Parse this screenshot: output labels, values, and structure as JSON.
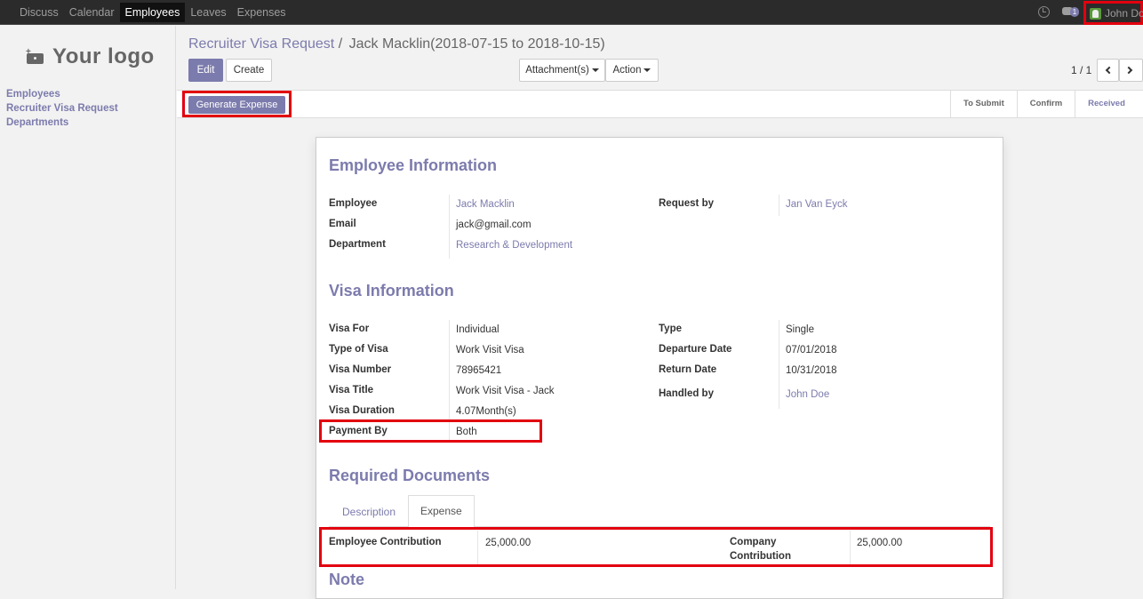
{
  "topbar": {
    "menu": [
      "Discuss",
      "Calendar",
      "Employees",
      "Leaves",
      "Expenses"
    ],
    "active_index": 2,
    "chat_count": "1",
    "user_name": "John Doe"
  },
  "sidebar": {
    "logo_text": "Your logo",
    "links": [
      "Employees",
      "Recruiter Visa Request",
      "Departments"
    ]
  },
  "breadcrumb": {
    "parent": "Recruiter Visa Request",
    "separator": "/",
    "current": "Jack Macklin(2018-07-15 to 2018-10-15)"
  },
  "toolbar": {
    "edit_label": "Edit",
    "create_label": "Create",
    "attachments_label": "Attachment(s)",
    "action_label": "Action",
    "pager": "1 / 1"
  },
  "statusbar": {
    "generate_label": "Generate Expense",
    "stages": [
      "To Submit",
      "Confirm",
      "Received"
    ],
    "current_stage": "Received"
  },
  "employee_info": {
    "heading": "Employee Information",
    "employee_label": "Employee",
    "employee_value": "Jack Macklin",
    "email_label": "Email",
    "email_value": "jack@gmail.com",
    "department_label": "Department",
    "department_value": "Research & Development",
    "request_by_label": "Request by",
    "request_by_value": "Jan Van Eyck"
  },
  "visa_info": {
    "heading": "Visa Information",
    "visa_for_label": "Visa For",
    "visa_for_value": "Individual",
    "type_of_visa_label": "Type of Visa",
    "type_of_visa_value": "Work Visit Visa",
    "visa_number_label": "Visa Number",
    "visa_number_value": "78965421",
    "visa_title_label": "Visa Title",
    "visa_title_value": "Work Visit Visa - Jack",
    "visa_duration_label": "Visa Duration",
    "visa_duration_value": "4.07Month(s)",
    "payment_by_label": "Payment By",
    "payment_by_value": "Both",
    "type_label": "Type",
    "type_value": "Single",
    "departure_label": "Departure Date",
    "departure_value": "07/01/2018",
    "return_label": "Return Date",
    "return_value": "10/31/2018",
    "handled_label": "Handled by",
    "handled_value": "John Doe"
  },
  "documents": {
    "heading": "Required Documents",
    "tabs": [
      "Description",
      "Expense"
    ],
    "active_tab": "Expense",
    "employee_contribution_label": "Employee Contribution",
    "employee_contribution_value": "25,000.00",
    "company_contribution_label_1": "Company",
    "company_contribution_label_2": "Contribution",
    "company_contribution_value": "25,000.00"
  },
  "note": {
    "heading": "Note"
  }
}
